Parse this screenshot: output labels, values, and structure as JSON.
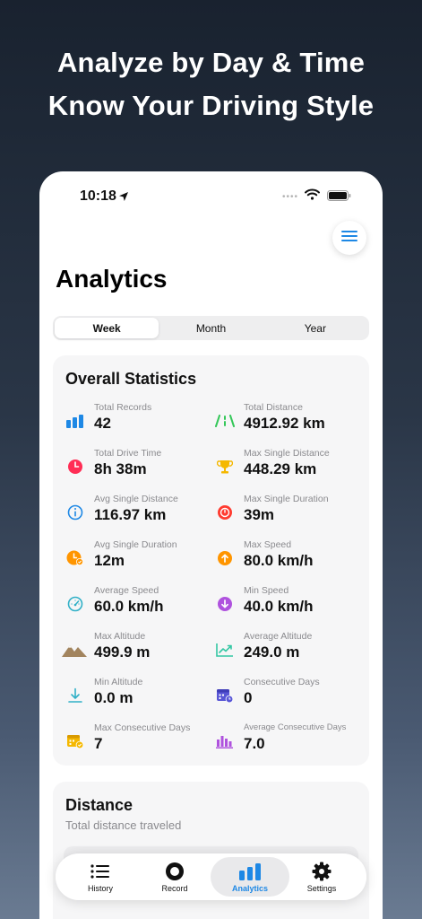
{
  "headline": {
    "line1": "Analyze by Day & Time",
    "line2": "Know Your Driving Style"
  },
  "status_bar": {
    "time": "10:18",
    "icons": [
      "location-arrow-icon",
      "signal-dots-icon",
      "wifi-icon",
      "battery-icon"
    ]
  },
  "page": {
    "title": "Analytics"
  },
  "segments": {
    "selected": "Week",
    "items": [
      "Week",
      "Month",
      "Year"
    ]
  },
  "overall": {
    "title": "Overall Statistics",
    "stats": [
      {
        "label": "Total Records",
        "value": "42",
        "icon": "bar-chart-icon",
        "color": "#1e88e5"
      },
      {
        "label": "Total Distance",
        "value": "4912.92 km",
        "icon": "road-icon",
        "color": "#34c759"
      },
      {
        "label": "Total Drive Time",
        "value": "8h 38m",
        "icon": "clock-icon",
        "color": "#ff2d55"
      },
      {
        "label": "Max Single Distance",
        "value": "448.29 km",
        "icon": "trophy-icon",
        "color": "#f5b800"
      },
      {
        "label": "Avg Single Distance",
        "value": "116.97 km",
        "icon": "info-circle-icon",
        "color": "#1e88e5"
      },
      {
        "label": "Max Single Duration",
        "value": "39m",
        "icon": "stopwatch-icon",
        "color": "#ff3b30"
      },
      {
        "label": "Avg Single Duration",
        "value": "12m",
        "icon": "clock-check-icon",
        "color": "#ff9500"
      },
      {
        "label": "Max Speed",
        "value": "80.0 km/h",
        "icon": "arrow-up-circle-icon",
        "color": "#ff9500"
      },
      {
        "label": "Average Speed",
        "value": "60.0 km/h",
        "icon": "speedometer-icon",
        "color": "#30b0c7"
      },
      {
        "label": "Min Speed",
        "value": "40.0 km/h",
        "icon": "arrow-down-circle-icon",
        "color": "#af52de"
      },
      {
        "label": "Max Altitude",
        "value": "499.9 m",
        "icon": "mountain-icon",
        "color": "#a2845e"
      },
      {
        "label": "Average Altitude",
        "value": "249.0 m",
        "icon": "trend-up-icon",
        "color": "#34c7a4"
      },
      {
        "label": "Min Altitude",
        "value": "0.0 m",
        "icon": "arrow-down-to-line-icon",
        "color": "#30b0c7"
      },
      {
        "label": "Consecutive Days",
        "value": "0",
        "icon": "calendar-clock-icon",
        "color": "#5856d6"
      },
      {
        "label": "Max Consecutive Days",
        "value": "7",
        "icon": "calendar-check-icon",
        "color": "#f5b800"
      },
      {
        "label": "Average Consecutive Days",
        "value": "7.0",
        "icon": "histogram-icon",
        "color": "#af52de"
      }
    ]
  },
  "distance": {
    "title": "Distance",
    "subtitle": "Total distance traveled"
  },
  "tabbar": {
    "active": "Analytics",
    "items": [
      {
        "label": "History",
        "icon": "list-icon"
      },
      {
        "label": "Record",
        "icon": "record-icon"
      },
      {
        "label": "Analytics",
        "icon": "bar-chart-icon"
      },
      {
        "label": "Settings",
        "icon": "gear-icon"
      }
    ]
  }
}
